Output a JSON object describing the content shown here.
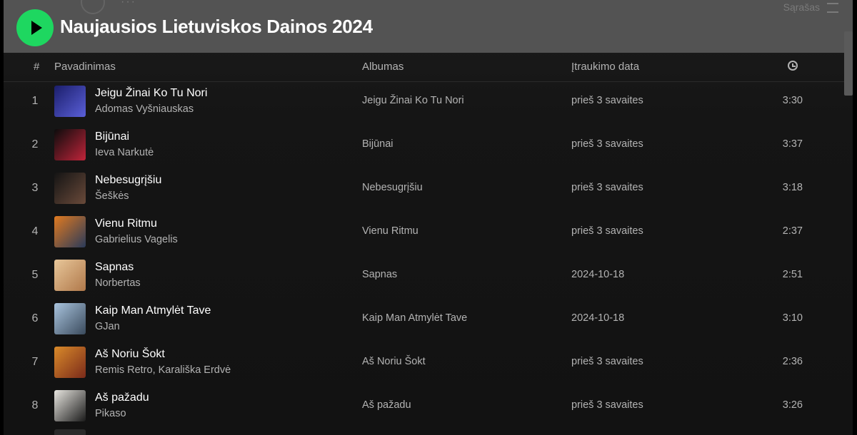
{
  "playlist": {
    "title": "Naujausios Lietuviskos Dainos 2024",
    "list_label": "Sąrašas"
  },
  "columns": {
    "number": "#",
    "title": "Pavadinimas",
    "album": "Albumas",
    "date_added": "Įtraukimo data",
    "duration_icon": "clock-icon"
  },
  "tracks": [
    {
      "num": "1",
      "title": "Jeigu Žinai Ko Tu Nori",
      "artist": "Adomas Vyšniauskas",
      "album": "Jeigu Žinai Ko Tu Nori",
      "added": "prieš 3 savaites",
      "duration": "3:30",
      "cover": [
        "#1b1e6b",
        "#5a5fd8"
      ]
    },
    {
      "num": "2",
      "title": "Bijūnai",
      "artist": "Ieva Narkutė",
      "album": "Bijūnai",
      "added": "prieš 3 savaites",
      "duration": "3:37",
      "cover": [
        "#0c0c0c",
        "#c0243a"
      ]
    },
    {
      "num": "3",
      "title": "Nebesugrįšiu",
      "artist": "Šeškės",
      "album": "Nebesugrįšiu",
      "added": "prieš 3 savaites",
      "duration": "3:18",
      "cover": [
        "#141414",
        "#6a4a3a"
      ]
    },
    {
      "num": "4",
      "title": "Vienu Ritmu",
      "artist": "Gabrielius Vagelis",
      "album": "Vienu Ritmu",
      "added": "prieš 3 savaites",
      "duration": "2:37",
      "cover": [
        "#e07a20",
        "#2a3a5a"
      ]
    },
    {
      "num": "5",
      "title": "Sapnas",
      "artist": "Norbertas",
      "album": "Sapnas",
      "added": "2024-10-18",
      "duration": "2:51",
      "cover": [
        "#e8c79a",
        "#b0784a"
      ]
    },
    {
      "num": "6",
      "title": "Kaip Man Atmylėt Tave",
      "artist": "GJan",
      "album": "Kaip Man Atmylėt Tave",
      "added": "2024-10-18",
      "duration": "3:10",
      "cover": [
        "#a9c4de",
        "#3a4a5c"
      ]
    },
    {
      "num": "7",
      "title": "Aš Noriu Šokt",
      "artist": "Remis Retro, Karališka Erdvė",
      "album": "Aš Noriu Šokt",
      "added": "prieš 3 savaites",
      "duration": "2:36",
      "cover": [
        "#d98a2a",
        "#7a2a1a"
      ]
    },
    {
      "num": "8",
      "title": "Aš pažadu",
      "artist": "Pikaso",
      "album": "Aš pažadu",
      "added": "prieš 3 savaites",
      "duration": "3:26",
      "cover": [
        "#e8e6e0",
        "#1a1a1a"
      ]
    }
  ]
}
